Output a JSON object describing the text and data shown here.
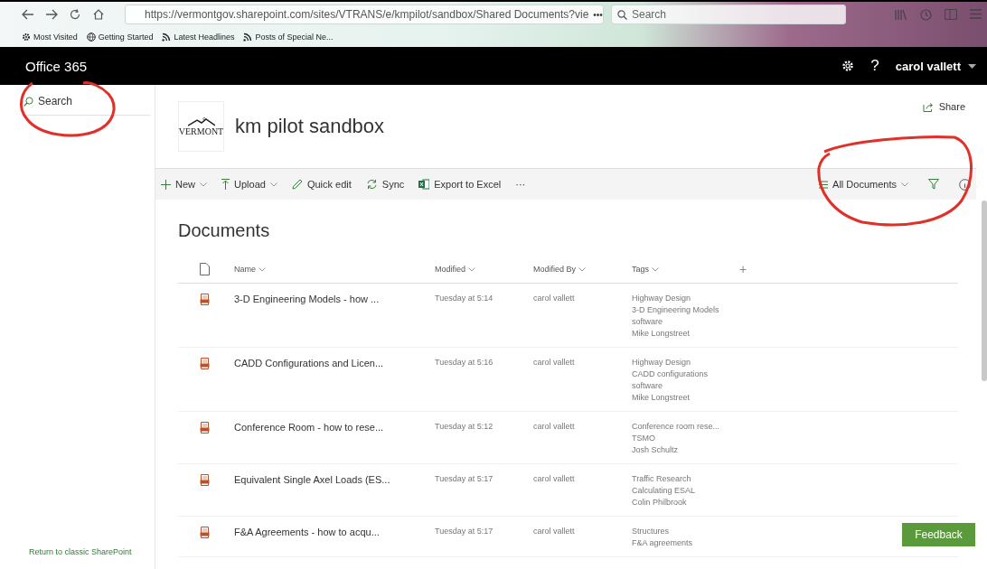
{
  "browser": {
    "url": "https://vermontgov.sharepoint.com/sites/VTRANS/e/kmpilot/sandbox/Shared Documents?vie",
    "more": "•••",
    "search_placeholder": "Search",
    "bookmarks": [
      {
        "label": "Most Visited",
        "kind": "gear"
      },
      {
        "label": "Getting Started",
        "kind": "globe"
      },
      {
        "label": "Latest Headlines",
        "kind": "feed"
      },
      {
        "label": "Posts of Special Ne...",
        "kind": "feed"
      }
    ]
  },
  "suite_bar": {
    "app_name": "Office 365",
    "help": "?",
    "user": "carol vallett"
  },
  "sidebar": {
    "search_placeholder": "Search",
    "footer_link": "Return to classic SharePoint"
  },
  "site": {
    "logo_text": "VERMONT",
    "title": "km pilot sandbox",
    "share": "Share"
  },
  "command_bar": {
    "items": [
      {
        "label": "New",
        "kind": "new",
        "dropdown": true
      },
      {
        "label": "Upload",
        "kind": "upload",
        "dropdown": true
      },
      {
        "label": "Quick edit",
        "kind": "edit",
        "dropdown": false
      },
      {
        "label": "Sync",
        "kind": "sync",
        "dropdown": false
      },
      {
        "label": "Export to Excel",
        "kind": "excel",
        "dropdown": false
      },
      {
        "label": "···",
        "kind": "more",
        "dropdown": false
      }
    ],
    "view": "All Documents"
  },
  "library": {
    "title": "Documents",
    "columns": [
      "Name",
      "Modified",
      "Modified By",
      "Tags"
    ],
    "add_column": "+",
    "rows": [
      {
        "name": "3-D Engineering Models - how ...",
        "modified": "Tuesday at 5:14",
        "modified_by": "carol vallett",
        "tags": [
          "Highway Design",
          "3-D Engineering Models",
          "software",
          "Mike Longstreet"
        ]
      },
      {
        "name": "CADD Configurations and Licen...",
        "modified": "Tuesday at 5:16",
        "modified_by": "carol vallett",
        "tags": [
          "Highway Design",
          "CADD configurations",
          "software",
          "Mike Longstreet"
        ]
      },
      {
        "name": "Conference Room - how to rese...",
        "modified": "Tuesday at 5:12",
        "modified_by": "carol vallett",
        "tags": [
          "Conference room rese...",
          "TSMO",
          "Josh Schultz"
        ]
      },
      {
        "name": "Equivalent Single Axel Loads (ES...",
        "modified": "Tuesday at 5:17",
        "modified_by": "carol vallett",
        "tags": [
          "Traffic Research",
          "Calculating ESAL",
          "Colin Philbrook"
        ]
      },
      {
        "name": "F&A Agreements - how to acqu...",
        "modified": "Tuesday at 5:17",
        "modified_by": "carol vallett",
        "tags": [
          "Structures",
          "F&A agreements"
        ]
      }
    ]
  },
  "feedback": "Feedback"
}
